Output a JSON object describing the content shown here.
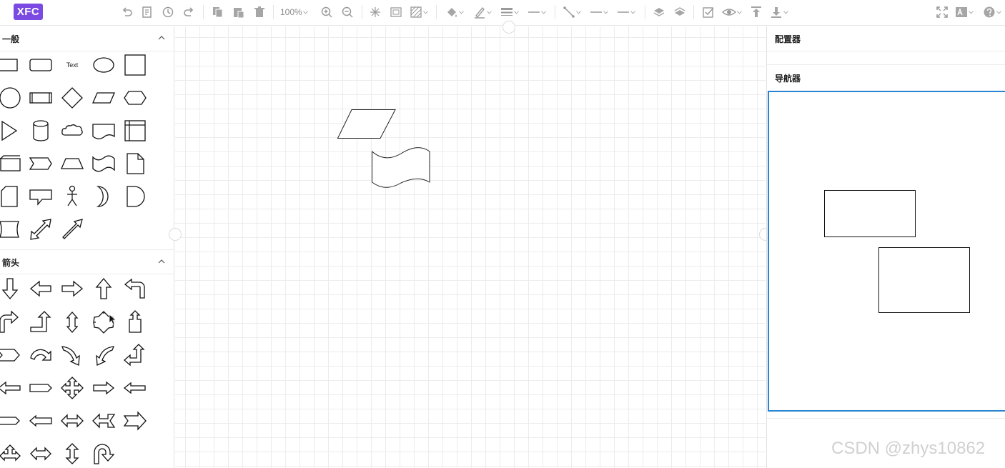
{
  "app": {
    "logo_text": "XFC"
  },
  "toolbar": {
    "zoom_level": "100%",
    "buttons": [
      "undo-icon",
      "format-painter-icon",
      "history-icon",
      "redo-icon",
      "copy-icon",
      "paste-icon",
      "delete-icon",
      "zoom-in-icon",
      "zoom-out-icon",
      "layout-icon",
      "frame-icon",
      "pattern-icon",
      "fill-color-icon",
      "line-color-icon",
      "line-width-icon",
      "line-style-icon",
      "connector-icon",
      "start-arrow-icon",
      "end-arrow-icon",
      "bring-front-icon",
      "send-back-icon",
      "checkbox-icon",
      "view-icon",
      "align-top-icon",
      "align-bottom-icon",
      "fullscreen-icon",
      "text-style-icon",
      "help-icon"
    ]
  },
  "left_panel": {
    "sections": [
      {
        "title": "一般",
        "text_shape_label": "Text"
      },
      {
        "title": "箭头"
      }
    ]
  },
  "right_panel": {
    "configurator_title": "配置器",
    "navigator_title": "导航器"
  },
  "watermark": "CSDN @zhys10862",
  "colors": {
    "logo_bg": "#7b4ae2",
    "navigator_border": "#2a84d2",
    "icon": "#9a9a9a"
  }
}
